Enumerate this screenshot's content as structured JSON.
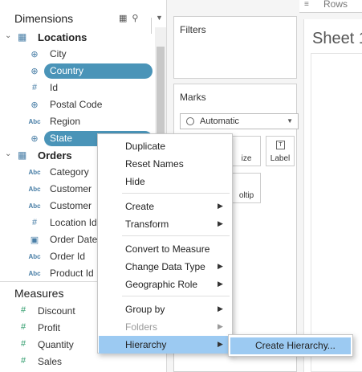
{
  "data_pane": {
    "dimensions_title": "Dimensions",
    "groups": [
      {
        "name": "Locations",
        "fields": [
          {
            "label": "City",
            "type": "geo"
          },
          {
            "label": "Country",
            "type": "geo",
            "selected": true
          },
          {
            "label": "Id",
            "type": "number"
          },
          {
            "label": "Postal Code",
            "type": "geo"
          },
          {
            "label": "Region",
            "type": "string"
          },
          {
            "label": "State",
            "type": "geo",
            "selected": true
          }
        ]
      },
      {
        "name": "Orders",
        "fields": [
          {
            "label": "Category",
            "type": "string"
          },
          {
            "label": "Customer",
            "type": "string"
          },
          {
            "label": "Customer",
            "type": "string"
          },
          {
            "label": "Location Id",
            "type": "number"
          },
          {
            "label": "Order Date",
            "type": "date"
          },
          {
            "label": "Order Id",
            "type": "string"
          },
          {
            "label": "Product Id",
            "type": "string"
          }
        ]
      }
    ],
    "measures_title": "Measures",
    "measures": [
      {
        "label": "Discount"
      },
      {
        "label": "Profit"
      },
      {
        "label": "Quantity"
      },
      {
        "label": "Sales"
      }
    ]
  },
  "filters": {
    "title": "Filters"
  },
  "marks": {
    "title": "Marks",
    "mark_type": "Automatic",
    "buttons": [
      "ize",
      "Label",
      "oltip"
    ]
  },
  "shelf": {
    "rows_label": "Rows"
  },
  "sheet": {
    "title": "Sheet 1"
  },
  "context_menu": {
    "items": [
      {
        "label": "Duplicate"
      },
      {
        "label": "Reset Names"
      },
      {
        "label": "Hide"
      },
      {
        "label": "Create",
        "submenu": true
      },
      {
        "label": "Transform",
        "submenu": true
      },
      {
        "label": "Convert to Measure"
      },
      {
        "label": "Change Data Type",
        "submenu": true
      },
      {
        "label": "Geographic Role",
        "submenu": true
      },
      {
        "label": "Group by",
        "submenu": true
      },
      {
        "label": "Folders",
        "submenu": true,
        "disabled": true
      },
      {
        "label": "Hierarchy",
        "submenu": true,
        "highlighted": true
      }
    ],
    "submenu_item": "Create Hierarchy..."
  },
  "colors": {
    "selection_pill": "#4a94b8",
    "menu_highlight": "#9ccaf2",
    "dimension_icon": "#4a7fa7",
    "measure_icon": "#2d9b6a"
  }
}
